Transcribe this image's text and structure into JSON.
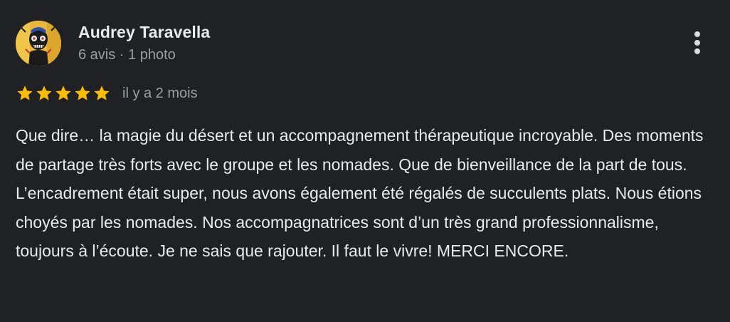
{
  "review": {
    "author": {
      "name": "Audrey Taravella",
      "meta": "6 avis · 1 photo",
      "avatar": "avatar-painting"
    },
    "rating": {
      "stars": 5,
      "max": 5,
      "star_color": "#fbbc04",
      "icon": "star-icon"
    },
    "date": "il y a 2 mois",
    "more_icon": "more-vert-icon",
    "text": {
      "paragraph_1": "Que dire… la magie du désert et un accompagnement thérapeutique incroyable. Des moments de partage très forts avec le groupe et les nomades. Que de bienveillance de la part de tous.",
      "paragraph_2": "L’encadrement était super, nous avons également été régalés de succulents plats. Nous étions choyés par les nomades. Nos accompagnatrices sont d’un très grand professionnalisme, toujours à l’écoute. Je ne sais que rajouter. Il faut le vivre! MERCI ENCORE."
    }
  },
  "colors": {
    "background": "#202124",
    "text_primary": "#e8eaed",
    "text_secondary": "#9aa0a6"
  }
}
